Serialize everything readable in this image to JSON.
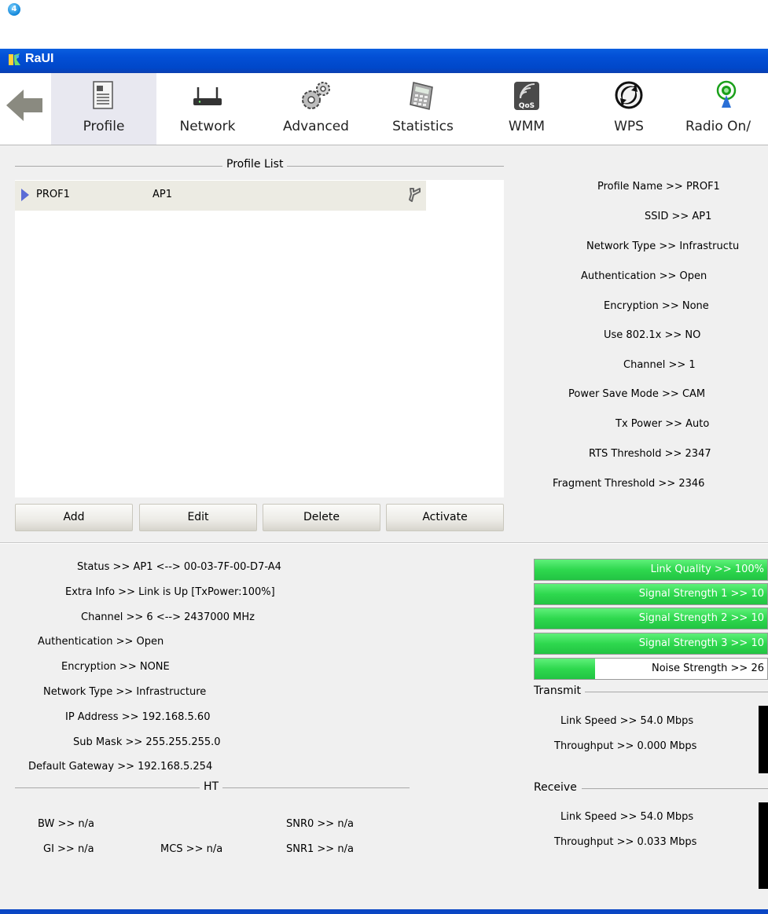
{
  "step_marker": "4",
  "window": {
    "title": "RaUI"
  },
  "toolbar": {
    "items": [
      {
        "label": "Profile",
        "icon": "profile-icon"
      },
      {
        "label": "Network",
        "icon": "router-icon"
      },
      {
        "label": "Advanced",
        "icon": "gears-icon"
      },
      {
        "label": "Statistics",
        "icon": "calculator-icon"
      },
      {
        "label": "WMM",
        "icon": "qos-icon"
      },
      {
        "label": "WPS",
        "icon": "wps-icon"
      },
      {
        "label": "Radio On/",
        "icon": "radio-antenna-icon"
      }
    ]
  },
  "profile_list": {
    "title": "Profile List",
    "rows": [
      {
        "profile": "PROF1",
        "ssid": "AP1"
      }
    ],
    "buttons": {
      "add": "Add",
      "edit": "Edit",
      "delete": "Delete",
      "activate": "Activate"
    }
  },
  "profile_details": [
    {
      "key": "Profile Name >> ",
      "value": "PROF1"
    },
    {
      "key": "SSID >> ",
      "value": "AP1"
    },
    {
      "key": "Network Type >> ",
      "value": "Infrastructu"
    },
    {
      "key": "Authentication >> ",
      "value": "Open"
    },
    {
      "key": "Encryption >> ",
      "value": "None"
    },
    {
      "key": "Use 802.1x >> ",
      "value": "NO"
    },
    {
      "key": "Channel >> ",
      "value": "1"
    },
    {
      "key": "Power Save Mode >> ",
      "value": "CAM"
    },
    {
      "key": "Tx Power >> ",
      "value": "Auto"
    },
    {
      "key": "RTS Threshold >> ",
      "value": "2347"
    },
    {
      "key": "Fragment Threshold >> ",
      "value": "2346"
    }
  ],
  "status": [
    {
      "key": "Status >> ",
      "value": "AP1 <--> 00-03-7F-00-D7-A4"
    },
    {
      "key": "Extra Info >> ",
      "value": "Link is Up [TxPower:100%]"
    },
    {
      "key": "Channel >> ",
      "value": "6 <--> 2437000 MHz"
    },
    {
      "key": "Authentication >> ",
      "value": "Open"
    },
    {
      "key": "Encryption >> ",
      "value": "NONE"
    },
    {
      "key": "Network Type >> ",
      "value": "Infrastructure"
    },
    {
      "key": "IP Address >> ",
      "value": "192.168.5.60"
    },
    {
      "key": "Sub Mask >> ",
      "value": "255.255.255.0"
    },
    {
      "key": "Default Gateway >> ",
      "value": "192.168.5.254"
    }
  ],
  "ht": {
    "title": "HT",
    "bw": "BW >> n/a",
    "gi": "GI >> n/a",
    "mcs": "MCS >> n/a",
    "snr0": "SNR0 >> n/a",
    "snr1": "SNR1 >> n/a"
  },
  "signal": {
    "link_quality": {
      "label": "Link Quality >> 100%",
      "level": 1.0
    },
    "signal_1": {
      "label": "Signal Strength 1 >> 10",
      "level": 1.0
    },
    "signal_2": {
      "label": "Signal Strength 2 >> 10",
      "level": 1.0
    },
    "signal_3": {
      "label": "Signal Strength 3 >> 10",
      "level": 1.0
    },
    "noise": {
      "label": "Noise Strength >> 26",
      "level": 0.26
    }
  },
  "transmit": {
    "title": "Transmit",
    "link_speed": "Link Speed >> 54.0 Mbps",
    "throughput": "Throughput >> 0.000 Mbps"
  },
  "receive": {
    "title": "Receive",
    "link_speed": "Link Speed >> 54.0 Mbps",
    "throughput": "Throughput >> 0.033 Mbps"
  },
  "colors": {
    "titlebar": "#0350d6",
    "signal_fill": "#2ed84e",
    "selected_tab": "#e8e8f0"
  }
}
